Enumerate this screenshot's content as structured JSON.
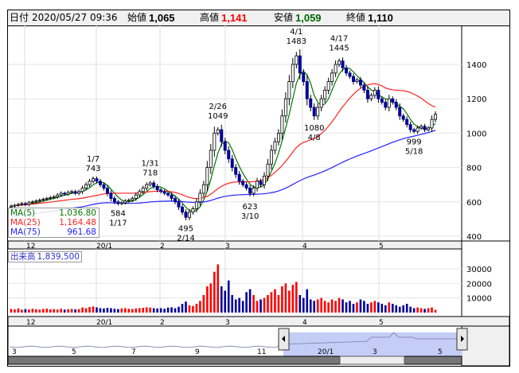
{
  "header": {
    "date_label": "日付",
    "date": "2020/05/27 09:36",
    "open_label": "始値",
    "open": "1,065",
    "high_label": "高値",
    "high": "1,141",
    "low_label": "安値",
    "low": "1,059",
    "close_label": "終値",
    "close": "1,110"
  },
  "colors": {
    "up": "#ff0000",
    "down": "#000099",
    "ma5": "#007700",
    "ma25": "#ff2222",
    "ma75": "#2222ff",
    "high_text": "#ff0000",
    "low_text": "#006600"
  },
  "price_axis": [
    "1400",
    "1200",
    "1000",
    "800",
    "600",
    "400"
  ],
  "volume_axis": [
    "30000",
    "20000",
    "10000"
  ],
  "date_axis": [
    "12",
    "20/1",
    "2",
    "3",
    "4",
    "5"
  ],
  "navigator_axis": [
    "3",
    "5",
    "7",
    "9",
    "11",
    "20/1",
    "3",
    "5"
  ],
  "annotations": [
    {
      "value": "743",
      "date": "1/7",
      "pos": "above",
      "idx": 23
    },
    {
      "value": "584",
      "date": "1/17",
      "pos": "below",
      "idx": 30
    },
    {
      "value": "718",
      "date": "1/31",
      "pos": "above",
      "idx": 39
    },
    {
      "value": "495",
      "date": "2/14",
      "pos": "below",
      "idx": 49
    },
    {
      "value": "1049",
      "date": "2/26",
      "pos": "above",
      "idx": 58
    },
    {
      "value": "623",
      "date": "3/10",
      "pos": "below",
      "idx": 67
    },
    {
      "value": "1483",
      "date": "4/1",
      "pos": "above",
      "idx": 80
    },
    {
      "value": "1080",
      "date": "4/8",
      "pos": "below",
      "idx": 85
    },
    {
      "value": "1445",
      "date": "4/17",
      "pos": "above",
      "idx": 92
    },
    {
      "value": "999",
      "date": "5/18",
      "pos": "below",
      "idx": 113
    }
  ],
  "legend": [
    {
      "name": "MA(5)",
      "value": "1,036.80"
    },
    {
      "name": "MA(25)",
      "value": "1,164.48"
    },
    {
      "name": "MA(75)",
      "value": "961.68"
    }
  ],
  "volume_label": {
    "name": "出来高",
    "value": "1,839,500"
  },
  "chart_data": {
    "type": "candlestick",
    "ylim": [
      400,
      1500
    ],
    "closes": [
      575,
      580,
      585,
      590,
      585,
      595,
      600,
      605,
      610,
      615,
      620,
      625,
      630,
      640,
      650,
      645,
      655,
      660,
      650,
      660,
      680,
      700,
      720,
      735,
      720,
      700,
      680,
      650,
      620,
      600,
      590,
      595,
      605,
      610,
      620,
      640,
      660,
      680,
      700,
      710,
      690,
      670,
      660,
      650,
      640,
      620,
      600,
      570,
      540,
      510,
      540,
      560,
      600,
      650,
      700,
      800,
      900,
      1000,
      1020,
      950,
      900,
      850,
      800,
      760,
      720,
      700,
      680,
      650,
      680,
      720,
      700,
      750,
      820,
      900,
      950,
      1000,
      1100,
      1200,
      1300,
      1400,
      1450,
      1350,
      1300,
      1200,
      1150,
      1100,
      1150,
      1200,
      1250,
      1300,
      1350,
      1400,
      1420,
      1380,
      1350,
      1330,
      1300,
      1310,
      1280,
      1250,
      1200,
      1220,
      1250,
      1200,
      1180,
      1150,
      1200,
      1180,
      1150,
      1100,
      1080,
      1050,
      1020,
      1010,
      1030,
      1040,
      1020,
      1030,
      1080,
      1110
    ],
    "volumes": [
      2500,
      2200,
      2800,
      2000,
      2400,
      2100,
      2600,
      2300,
      2000,
      2500,
      2700,
      2200,
      2400,
      2100,
      2600,
      2000,
      2300,
      2500,
      2200,
      2400,
      3500,
      3000,
      3800,
      4200,
      3600,
      3000,
      2800,
      3200,
      3000,
      2600,
      2400,
      2800,
      3000,
      2600,
      2400,
      2800,
      3000,
      3200,
      3600,
      3400,
      3000,
      2800,
      3000,
      2600,
      3400,
      3600,
      3000,
      4000,
      6000,
      7500,
      5000,
      4500,
      6000,
      8000,
      12000,
      18000,
      20000,
      28000,
      33000,
      18000,
      15000,
      22000,
      12000,
      9000,
      10000,
      8000,
      14000,
      16000,
      12000,
      8000,
      9000,
      10000,
      12000,
      14000,
      16000,
      12000,
      18000,
      20000,
      15000,
      19000,
      21000,
      12000,
      10000,
      16000,
      9000,
      8000,
      9000,
      10000,
      8000,
      7000,
      9000,
      8000,
      10000,
      9000,
      7000,
      8000,
      6000,
      7000,
      9000,
      8000,
      6000,
      7000,
      8000,
      7000,
      6000,
      5000,
      7000,
      6000,
      5000,
      4000,
      5000,
      6000,
      4000,
      3000,
      3500,
      3000,
      2500,
      3000,
      3500,
      1840
    ]
  }
}
